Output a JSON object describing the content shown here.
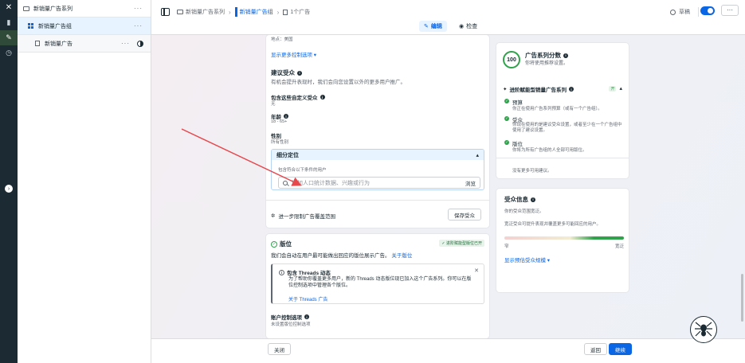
{
  "rail": {
    "items": [
      {
        "icon": "close-icon",
        "glyph": "✕"
      },
      {
        "icon": "chart-icon",
        "glyph": "▮"
      },
      {
        "icon": "edit-icon",
        "glyph": "✎"
      },
      {
        "icon": "clock-icon",
        "glyph": "◷"
      }
    ],
    "expand_glyph": "›"
  },
  "tree": {
    "campaign": {
      "label": "新销量广告系列",
      "more": "···"
    },
    "adset": {
      "label": "新销量广告组",
      "more": "···"
    },
    "ad": {
      "label": "新销量广告",
      "more": "···"
    }
  },
  "topbar": {
    "crumbs": [
      "新销量广告系列",
      "新销量广告组",
      "1个广告"
    ],
    "separator": "›",
    "status": "草稿",
    "more": "···",
    "edit_tab": "编辑",
    "edit_glyph": "✎",
    "check_tab": "检查",
    "check_glyph": "◉"
  },
  "audience": {
    "location": "地点：美国",
    "show_more": "显示更多控制选项 ▾",
    "suggested_title": "建议受众",
    "suggested_desc": "有机会提升表现时，我们会向您设置以外的更多用户推广。",
    "custom_title": "包含这些自定义受众",
    "custom_value": "无",
    "age_title": "年龄",
    "age_value": "18 - 65+",
    "gender_title": "性别",
    "gender_value": "所有性别",
    "detail_title": "细分定位",
    "detail_collapse": "▴",
    "detail_hint": "包含符合以下条件的用户",
    "search_placeholder": "添加人口统计数据、兴趣或行为",
    "browse": "浏览",
    "restrict_link": "进一步限制广告覆盖范围",
    "restrict_glyph": "✲",
    "save_button": "保存受众"
  },
  "placement": {
    "title": "版位",
    "title_glyph": "✓",
    "badge": "✓ 进阶赋能型版位已开",
    "desc": "我们会自动在用户最可能做出回应的版位展示广告。",
    "desc_link": "关于版位",
    "threads_title": "包含 Threads 动态",
    "threads_glyph": "i",
    "threads_close": "✕",
    "threads_desc": "为了帮助你覆盖更多用户，新的 Threads 动态版位现已加入这个广告系列。你可以在版位控制选项中管理各个版位。",
    "threads_link": "关于 Threads 广告",
    "account_title": "账户控制选项",
    "account_value": "未设置版位控制选项"
  },
  "score": {
    "value": "100",
    "title": "广告系列分数",
    "subtitle": "你将使用推荐设置。",
    "advantage_title": "进阶赋能型销量广告系列",
    "advantage_state": "开",
    "advantage_glyph": "▴",
    "items": [
      {
        "title": "预算",
        "desc": "你正在使用广告系列预算（或有一个广告组）。"
      },
      {
        "title": "受众",
        "desc": "你现在使用的是建议受众设置，或者至少在一个广告组中使用了建议设置。"
      },
      {
        "title": "版位",
        "desc": "你将为所有广告组的人全部可用版位。"
      }
    ],
    "no_more": "没有更多可用建议。"
  },
  "audience_info": {
    "title": "受众信息",
    "line1": "你的受众范围宽泛。",
    "line2": "宽泛受众可提升表现并覆盖更多可能回应的用户。",
    "meter_value": 1.0,
    "left_label": "窄",
    "right_label": "宽泛",
    "link": "显示预估受众规模 ▾"
  },
  "footer": {
    "close": "关闭",
    "back": "返回",
    "continue": "继续"
  },
  "colors": {
    "brand": "#0a66e4",
    "success": "#31a24c",
    "rail": "#1c2b33",
    "annotation_arrow": "#e5484d"
  }
}
